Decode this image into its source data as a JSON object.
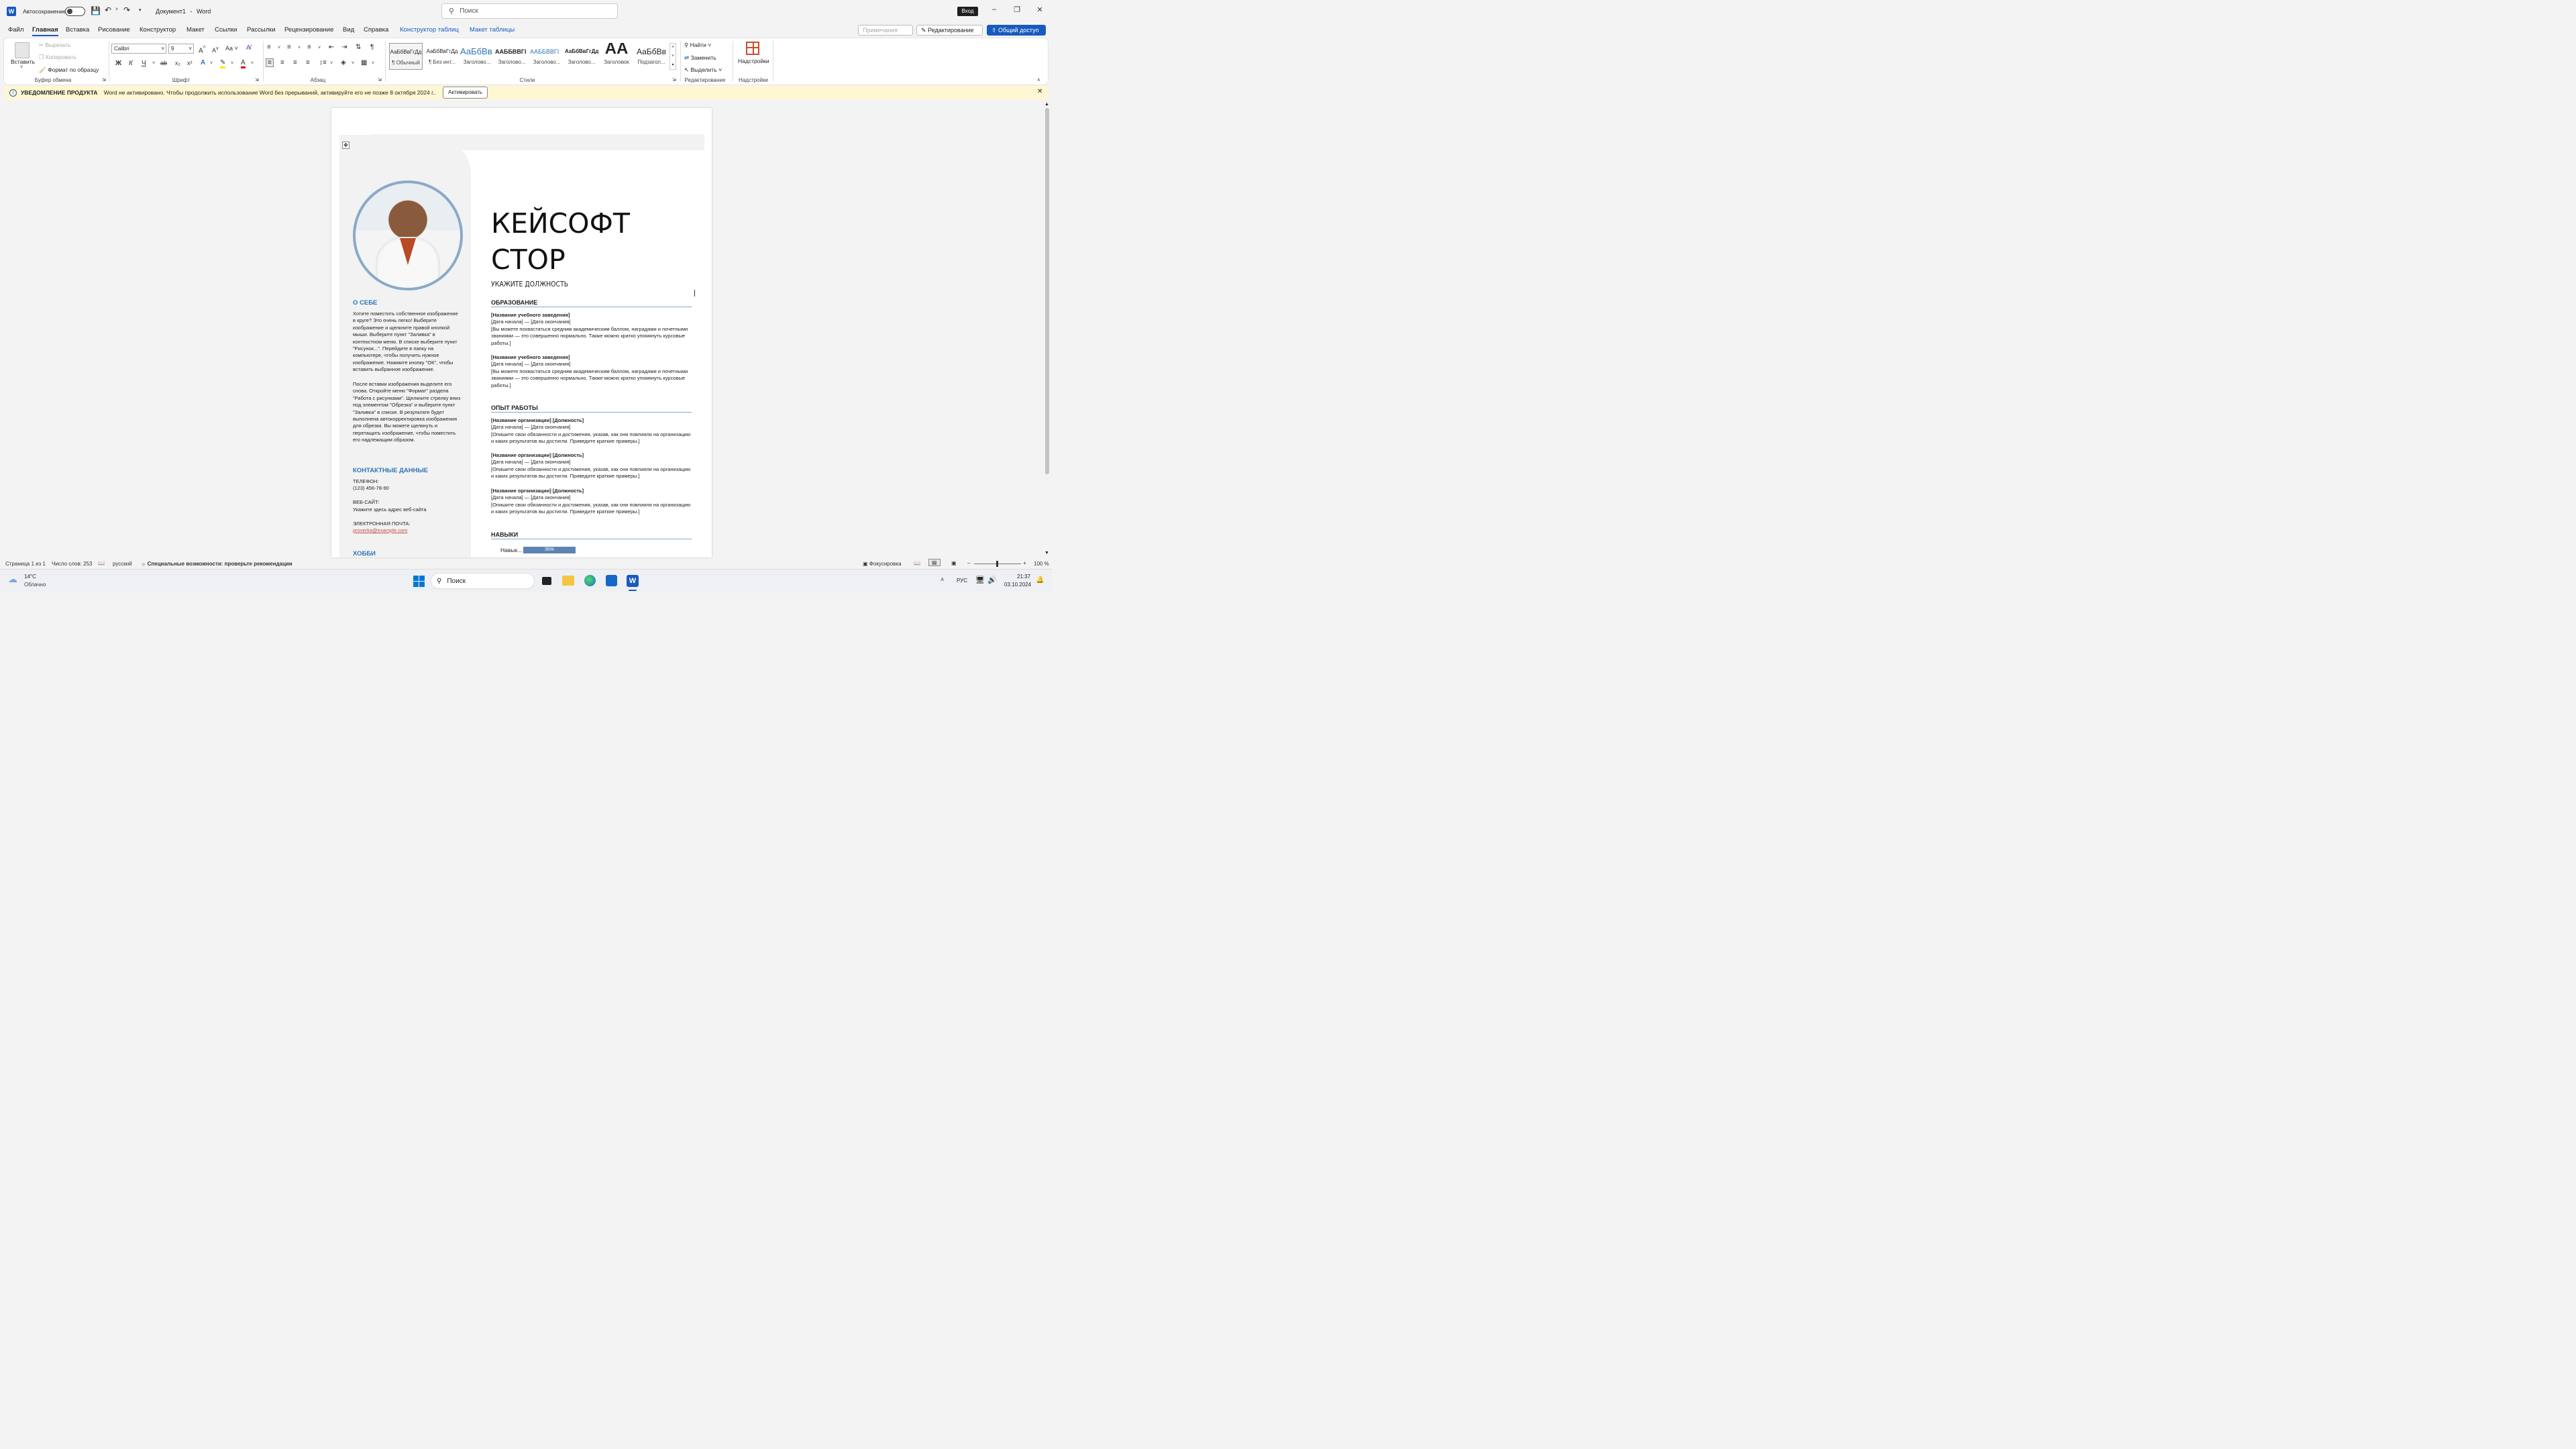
{
  "titlebar": {
    "autosave_label": "Автосохранение",
    "doc_title": "Документ1",
    "dash": "-",
    "app_name": "Word",
    "search_placeholder": "Поиск",
    "signin": "Вход"
  },
  "menu": {
    "items": [
      "Файл",
      "Главная",
      "Вставка",
      "Рисование",
      "Конструктор",
      "Макет",
      "Ссылки",
      "Рассылки",
      "Рецензирование",
      "Вид",
      "Справка",
      "Конструктор таблиц",
      "Макет таблицы"
    ],
    "comments": "Примечания",
    "editing": "Редактирование",
    "share": "Общий доступ"
  },
  "ribbon": {
    "clipboard": {
      "paste": "Вставить",
      "cut": "Вырезать",
      "copy": "Копировать",
      "format_painter": "Формат по образцу",
      "label": "Буфер обмена"
    },
    "font": {
      "name": "Calibri",
      "size": "9",
      "label": "Шрифт",
      "bold": "Ж",
      "italic": "К",
      "underline": "Ч",
      "strike": "ab",
      "sub": "x₂",
      "sup": "x²",
      "grow": "A",
      "shrink": "A",
      "case": "Aa"
    },
    "paragraph": {
      "label": "Абзац"
    },
    "styles": {
      "label": "Стили",
      "items": [
        {
          "preview": "АаБбВвГгДд",
          "name": "¶ Обычный"
        },
        {
          "preview": "АаБбВвГгДд",
          "name": "¶ Без инт..."
        },
        {
          "preview": "АаБбВв",
          "name": "Заголово..."
        },
        {
          "preview": "ААББВВГІ",
          "name": "Заголово..."
        },
        {
          "preview": "ААББВВГІ",
          "name": "Заголово..."
        },
        {
          "preview": "АаБбВвГгДд",
          "name": "Заголово..."
        },
        {
          "preview": "АА",
          "name": "Заголовок"
        },
        {
          "preview": "АаБбВв",
          "name": "Подзагол..."
        }
      ]
    },
    "editing": {
      "find": "Найти",
      "replace": "Заменить",
      "select": "Выделить",
      "label": "Редактирование"
    },
    "addins": {
      "button": "Надстройки",
      "label": "Надстройки"
    }
  },
  "notification": {
    "title": "УВЕДОМЛЕНИЕ ПРОДУКТА",
    "text": "Word не активировано. Чтобы продолжить использование Word без прерываний, активируйте его не позже 8 октября 2024 г..",
    "button": "Активировать"
  },
  "resume": {
    "name_line1": "КЕЙСОФТ",
    "name_line2": "СТОР",
    "job_title": "УКАЖИТЕ ДОЛЖНОСТЬ",
    "about_heading": "О СЕБЕ",
    "about_p1": "Хотите поместить собственное изображение в круге? Это очень легко! Выберите изображение и щелкните правой кнопкой мыши. Выберите пункт \"Заливка\" в контекстном меню. В списке выберите пункт \"Рисунок...\". Перейдите в папку на компьютере, чтобы получить нужное изображение. Нажмите кнопку \"ОК\", чтобы вставить выбранное изображение.",
    "about_p2": "После вставки изображения выделите его снова. Откройте меню \"Формат\" раздела \"Работа с рисунками\". Щелкните стрелку вниз под элементом \"Обрезка\" и выберите пункт \"Заливка\" в списке. В результате будет выполнена автокорректировка изображения для обрезки. Вы можете щелкнуть и перетащить изображение, чтобы поместить его надлежащим образом.",
    "contacts_heading": "КОНТАКТНЫЕ ДАННЫЕ",
    "phone_label": "ТЕЛЕФОН:",
    "phone": "(123) 456-78-90",
    "web_label": "ВЕБ-САЙТ:",
    "web": "Укажите здесь адрес веб-сайта",
    "email_label": "ЭЛЕКТРОННАЯ ПОЧТА:",
    "email": "proverka@example.com",
    "hobby_heading": "ХОББИ",
    "education_heading": "ОБРАЗОВАНИЕ",
    "education": [
      {
        "school": "[Название учебного заведения]",
        "dates": "[Дата начала] — [Дата окончания]",
        "desc": "[Вы можете похвастаться средним академическим баллом, наградами и почетными званиями — это совершенно нормально. Также можно кратко упомянуть курсовые работы.]"
      },
      {
        "school": "[Название учебного заведения]",
        "dates": "[Дата начала] — [Дата окончания]",
        "desc": "[Вы можете похвастаться средним академическим баллом, наградами и почетными званиями — это совершенно нормально. Также можно кратко упомянуть курсовые работы.]"
      }
    ],
    "work_heading": "ОПЫТ РАБОТЫ",
    "work": [
      {
        "org": "[Название организации] [Должность]",
        "dates": "[Дата начала] — [Дата окончания]",
        "desc": "[Опишите свои обязанности и достижения, указав, как они повлияли на организацию и каких результатов вы достигли. Приведите краткие примеры.]"
      },
      {
        "org": "[Название организации] [Должность]",
        "dates": "[Дата начала] — [Дата окончания]",
        "desc": "[Опишите свои обязанности и достижения, указав, как они повлияли на организацию и каких результатов вы достигли. Приведите краткие примеры.]"
      },
      {
        "org": "[Название организации] [Должность]",
        "dates": "[Дата начала] — [Дата окончания]",
        "desc": "[Опишите свои обязанности и достижения, указав, как они повлияли на организацию и каких результатов вы достигли. Приведите краткие примеры.]"
      }
    ],
    "skills_heading": "НАВЫКИ",
    "skill_name": "Навык...",
    "skill_value": "35%",
    "skill_fraction": 0.35
  },
  "statusbar": {
    "page": "Страница 1 из 1",
    "words": "Число слов: 253",
    "language": "русский",
    "accessibility": "Специальные возможности: проверьте рекомендации",
    "focus": "Фокусировка",
    "zoom": "100 %"
  },
  "taskbar": {
    "temp": "14°C",
    "weather": "Облачно",
    "search": "Поиск",
    "lang": "РУС",
    "time": "21:37",
    "date": "03.10.2024"
  },
  "colors": {
    "accent": "#185abd",
    "resume_blue": "#2e74b5",
    "photo_ring": "#8aa9c9",
    "notif_bg": "#fff7d1",
    "email": "#c0504d"
  }
}
